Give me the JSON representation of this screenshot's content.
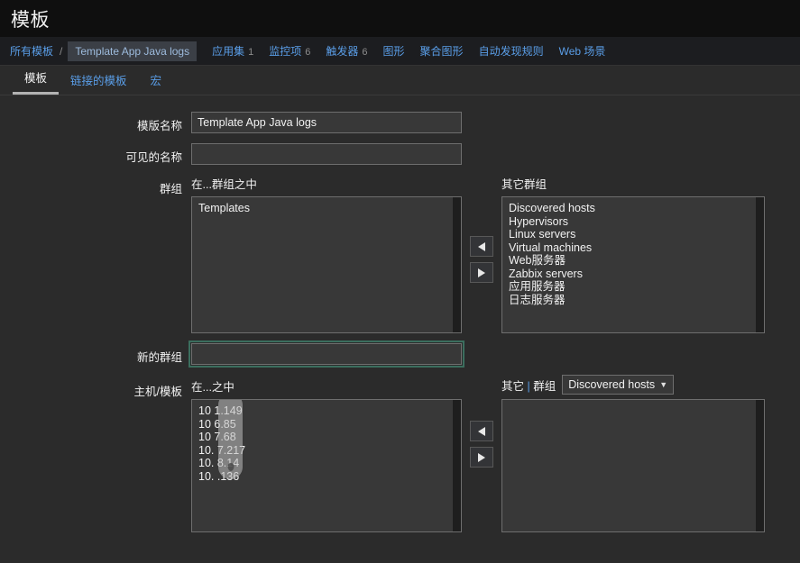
{
  "header": {
    "title": "模板"
  },
  "breadcrumb": {
    "all_templates": "所有模板",
    "separator": "/",
    "current": "Template App Java logs"
  },
  "nav": [
    {
      "label": "应用集",
      "count": "1"
    },
    {
      "label": "监控项",
      "count": "6"
    },
    {
      "label": "触发器",
      "count": "6"
    },
    {
      "label": "图形",
      "count": ""
    },
    {
      "label": "聚合图形",
      "count": ""
    },
    {
      "label": "自动发现规则",
      "count": ""
    },
    {
      "label": "Web 场景",
      "count": ""
    }
  ],
  "tabs": [
    {
      "label": "模板",
      "active": true
    },
    {
      "label": "链接的模板",
      "active": false
    },
    {
      "label": "宏",
      "active": false
    }
  ],
  "form": {
    "template_name": {
      "label": "模版名称",
      "value": "Template App Java logs",
      "placeholder": ""
    },
    "visible_name": {
      "label": "可见的名称",
      "value": "",
      "placeholder": ""
    },
    "groups": {
      "label": "群组",
      "in_groups_label": "在...群组之中",
      "other_groups_label": "其它群组",
      "in_groups": [
        "Templates"
      ],
      "other_groups": [
        "Discovered hosts",
        "Hypervisors",
        "Linux servers",
        "Virtual machines",
        "Web服务器",
        "Zabbix servers",
        "应用服务器",
        "日志服务器"
      ]
    },
    "new_group": {
      "label": "新的群组",
      "value": "",
      "placeholder": ""
    },
    "host_templates": {
      "label": "主机/模板",
      "in_label": "在...之中",
      "other_label": "其它",
      "other_group_label": "群组",
      "group_selected": "Discovered hosts",
      "in_items": [
        "10          1.149",
        "10          6.85",
        "10          7.68",
        "10.         7.217",
        "10.         8.14",
        "10.         .136"
      ],
      "other_items": []
    }
  },
  "buttons": {
    "move_left": "◀",
    "move_right": "▶"
  },
  "colors": {
    "background": "#2b2b2b",
    "header_bg": "#0f0f0f",
    "breadcrumb_bg": "#1c1d20",
    "link": "#5a9ee8",
    "input_bg": "#383838",
    "input_border": "#6e6e6e",
    "focus_ring": "#3b6e5e",
    "text": "#f2f2f2"
  }
}
